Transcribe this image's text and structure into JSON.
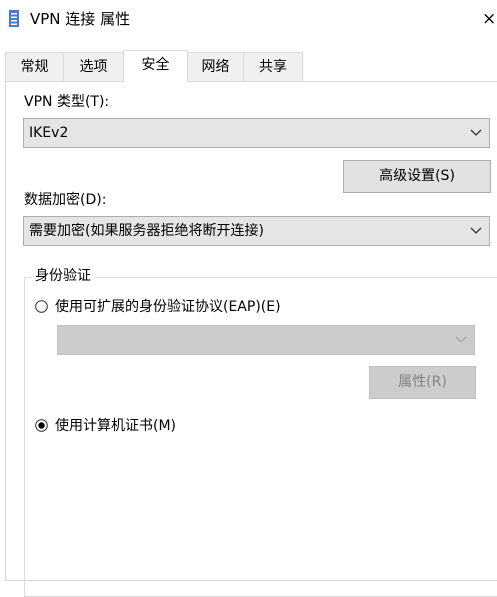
{
  "window": {
    "title": "VPN 连接 属性",
    "close_glyph": "×"
  },
  "tabs": [
    {
      "label": "常规",
      "active": false
    },
    {
      "label": "选项",
      "active": false
    },
    {
      "label": "安全",
      "active": true
    },
    {
      "label": "网络",
      "active": false
    },
    {
      "label": "共享",
      "active": false
    }
  ],
  "security": {
    "vpn_type_label": "VPN 类型(T):",
    "vpn_type_value": "IKEv2",
    "advanced_button": "高级设置(S)",
    "encryption_label": "数据加密(D):",
    "encryption_value": "需要加密(如果服务器拒绝将断开连接)",
    "auth_group_title": "身份验证",
    "eap_option": {
      "label": "使用可扩展的身份验证协议(EAP)(E)",
      "selected": false
    },
    "eap_dropdown_value": "",
    "properties_button": "属性(R)",
    "cert_option": {
      "label": "使用计算机证书(M)",
      "selected": true
    }
  },
  "colors": {
    "combo_bg": "#e5e5e5",
    "disabled_bg": "#cccccc",
    "disabled_text": "#838383",
    "border": "#adadad",
    "tab_bg": "#f0f0f0",
    "title_icon": "#4a7bc8"
  },
  "icons": {
    "title": "vpn-connection-icon",
    "close": "close-icon",
    "dropdown": "chevron-down-icon"
  }
}
